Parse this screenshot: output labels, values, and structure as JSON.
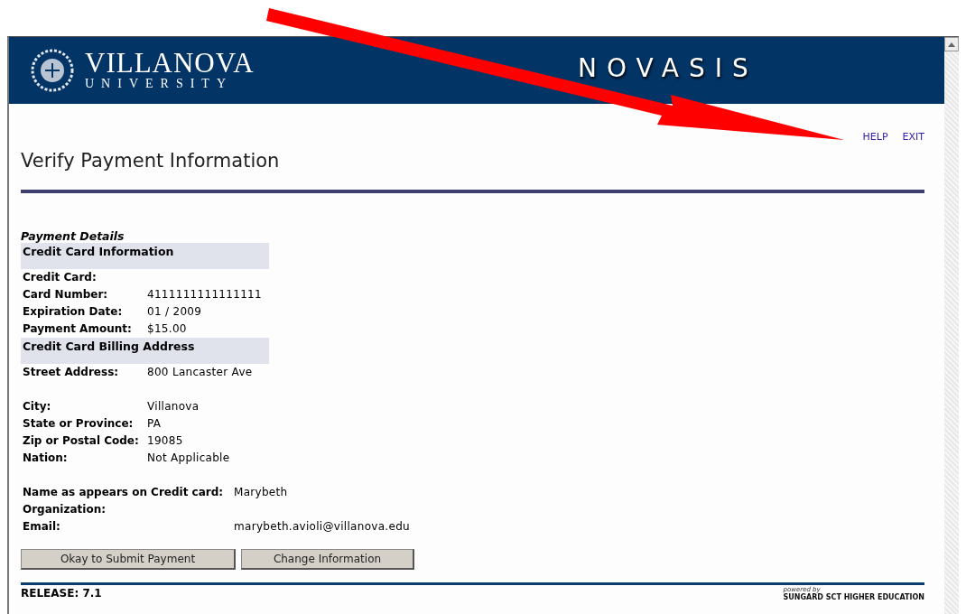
{
  "banner": {
    "university": "VILLANOVA",
    "university_sub": "UNIVERSITY",
    "app_name": "NOVASIS"
  },
  "links": [
    "HELP",
    "EXIT"
  ],
  "title": "Verify Payment Information",
  "section_title": "Payment Details",
  "card_section": {
    "heading": "Credit Card Information",
    "fields": [
      {
        "label": "Credit Card:"
      },
      {
        "label": "Card Number:",
        "value": "4111111111111111"
      },
      {
        "label": "Expiration Date:",
        "value": "01 / 2009"
      },
      {
        "label": "Payment Amount:",
        "value": "$15.00"
      }
    ]
  },
  "billing_section": {
    "heading": "Credit Card Billing Address",
    "fields": [
      {
        "label": "Street Address:",
        "value": "800 Lancaster Ave"
      }
    ]
  },
  "location_fields": [
    {
      "label": "City:",
      "value": "Villanova"
    },
    {
      "label": "State or Province:",
      "value": "PA"
    },
    {
      "label": "Zip or Postal Code:",
      "value": "19085"
    },
    {
      "label": "Nation:",
      "value": "Not Applicable"
    }
  ],
  "contact_fields": [
    {
      "label": "Name as appears on Credit card:",
      "value": "Marybeth"
    },
    {
      "label": "Organization:"
    },
    {
      "label": "Email:",
      "value": "marybeth.avioli@villanova.edu"
    }
  ],
  "buttons": [
    "Okay to Submit Payment",
    "Change Information"
  ],
  "footer": {
    "release": "RELEASE: 7.1",
    "powered_by": "powered by",
    "vendor": "SUNGARD SCT HIGHER EDUCATION"
  }
}
